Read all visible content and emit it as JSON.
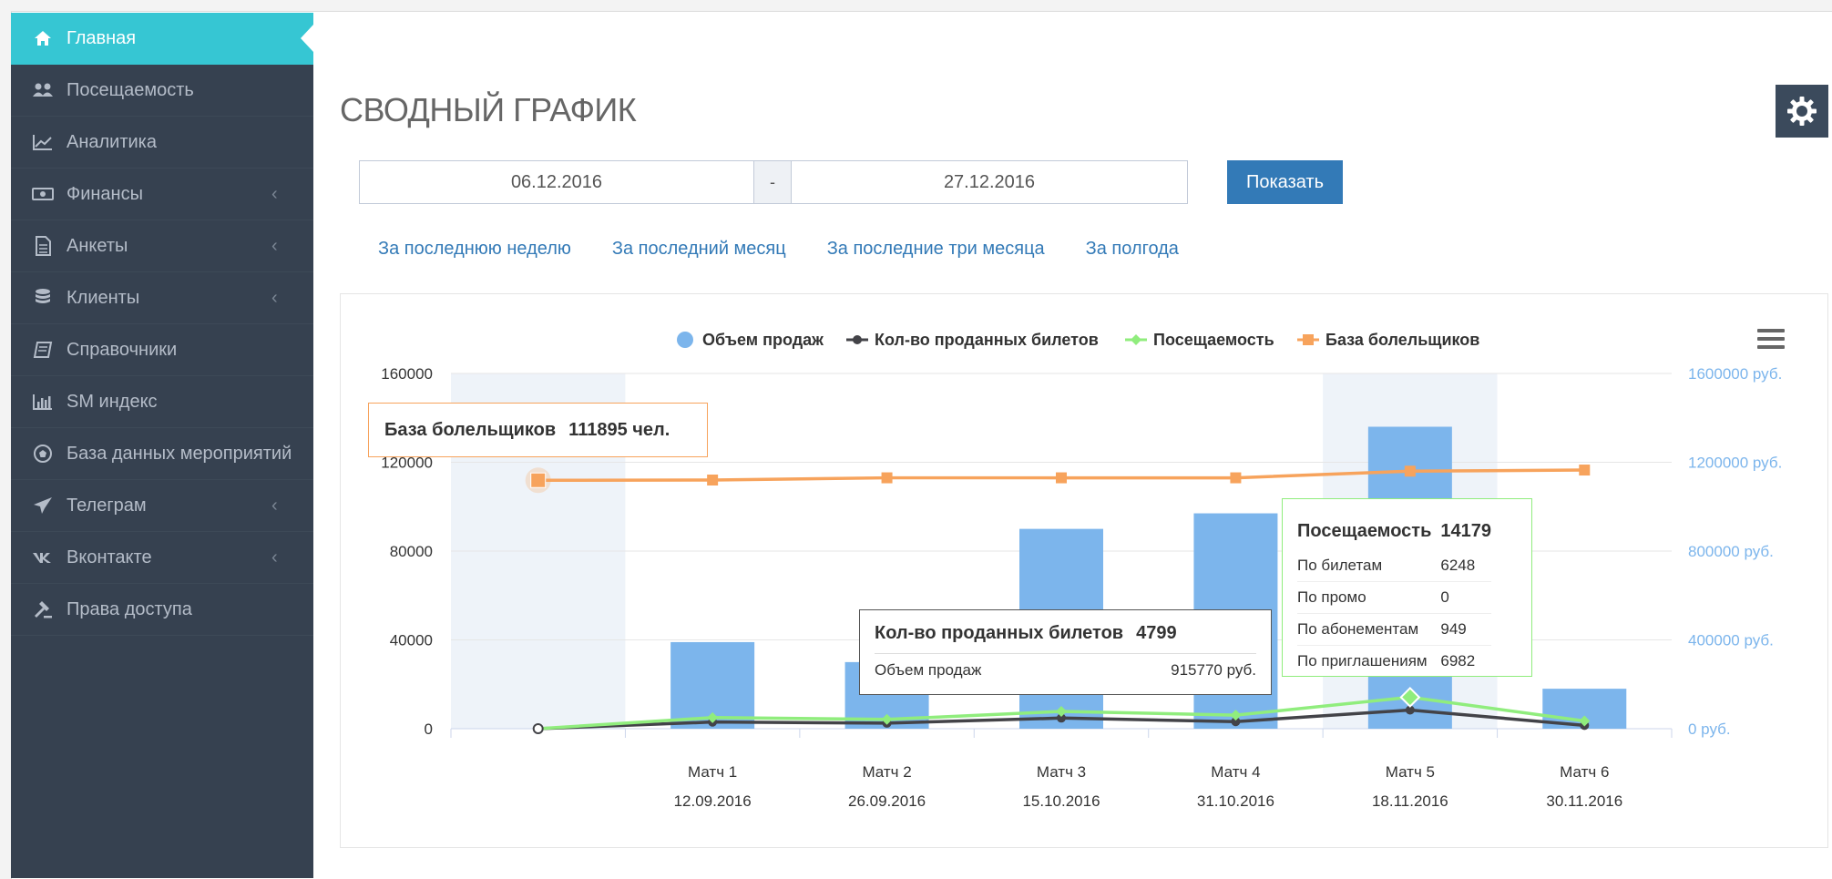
{
  "sidebar": {
    "items": [
      {
        "label": "Главная",
        "icon": "home-icon",
        "active": true,
        "has_submenu": false
      },
      {
        "label": "Посещаемость",
        "icon": "users-icon",
        "active": false,
        "has_submenu": false
      },
      {
        "label": "Аналитика",
        "icon": "line-chart-icon",
        "active": false,
        "has_submenu": false
      },
      {
        "label": "Финансы",
        "icon": "money-icon",
        "active": false,
        "has_submenu": true
      },
      {
        "label": "Анкеты",
        "icon": "document-icon",
        "active": false,
        "has_submenu": true
      },
      {
        "label": "Клиенты",
        "icon": "database-icon",
        "active": false,
        "has_submenu": true
      },
      {
        "label": "Справочники",
        "icon": "book-icon",
        "active": false,
        "has_submenu": false
      },
      {
        "label": "SM индекс",
        "icon": "bar-chart-icon",
        "active": false,
        "has_submenu": false
      },
      {
        "label": "База данных мероприятий",
        "icon": "soccer-ball-icon",
        "active": false,
        "has_submenu": false
      },
      {
        "label": "Телеграм",
        "icon": "paper-plane-icon",
        "active": false,
        "has_submenu": true
      },
      {
        "label": "Вконтакте",
        "icon": "vk-icon",
        "active": false,
        "has_submenu": true
      },
      {
        "label": "Права доступа",
        "icon": "gavel-icon",
        "active": false,
        "has_submenu": false
      }
    ]
  },
  "page": {
    "title": "СВОДНЫЙ ГРАФИК"
  },
  "filters": {
    "date_from": "06.12.2016",
    "separator": "-",
    "date_to": "27.12.2016",
    "show_button": "Показать",
    "quick_links": [
      "За последнюю неделю",
      "За последний месяц",
      "За последние три месяца",
      "За полгода"
    ]
  },
  "colors": {
    "sidebar_bg": "#364150",
    "active_item": "#36c6d3",
    "primary_button": "#337ab7",
    "series_sales": "#7cb5ec",
    "series_tickets": "#434348",
    "series_attendance": "#90ed7d",
    "series_fans": "#f7a35c"
  },
  "chart_data": {
    "type": "bar",
    "categories": [
      {
        "name": "",
        "date": ""
      },
      {
        "name": "Матч 1",
        "date": "12.09.2016"
      },
      {
        "name": "Матч 2",
        "date": "26.09.2016"
      },
      {
        "name": "Матч 3",
        "date": "15.10.2016"
      },
      {
        "name": "Матч 4",
        "date": "31.10.2016"
      },
      {
        "name": "Матч 5",
        "date": "18.11.2016"
      },
      {
        "name": "Матч 6",
        "date": "30.11.2016"
      }
    ],
    "y_left": {
      "min": 0,
      "max": 160000,
      "ticks": [
        "0",
        "40000",
        "80000",
        "120000",
        "160000"
      ]
    },
    "y_right": {
      "min": 0,
      "max": 1600000,
      "ticks": [
        "0 руб.",
        "400000 руб.",
        "800000 руб.",
        "1200000 руб.",
        "1600000 руб."
      ]
    },
    "grid": true,
    "legend_position": "top-center",
    "series": [
      {
        "name": "Объем продаж",
        "type": "column",
        "axis": "right",
        "values": [
          0,
          390000,
          300000,
          900000,
          970000,
          1360000,
          180000
        ]
      },
      {
        "name": "Кол-во проданных билетов",
        "type": "line",
        "axis": "left",
        "values": [
          0,
          3000,
          2500,
          4799,
          3200,
          8400,
          1500
        ]
      },
      {
        "name": "Посещаемость",
        "type": "line",
        "axis": "left",
        "values": [
          0,
          5000,
          4200,
          7800,
          6100,
          14179,
          3500
        ]
      },
      {
        "name": "База болельщиков",
        "type": "line",
        "axis": "left",
        "values": [
          111895,
          112000,
          113000,
          113000,
          113000,
          116000,
          116500
        ]
      }
    ]
  },
  "tooltips": {
    "fans": {
      "title": "База болельщиков",
      "value": "111895 чел."
    },
    "tickets": {
      "title": "Кол-во проданных билетов",
      "value": "4799",
      "sub_label": "Объем продаж",
      "sub_value": "915770 руб."
    },
    "attendance": {
      "title": "Посещаемость",
      "value": "14179",
      "rows": [
        {
          "label": "По билетам",
          "value": "6248"
        },
        {
          "label": "По промо",
          "value": "0"
        },
        {
          "label": "По абонементам",
          "value": "949"
        },
        {
          "label": "По приглашениям",
          "value": "6982"
        }
      ]
    }
  }
}
